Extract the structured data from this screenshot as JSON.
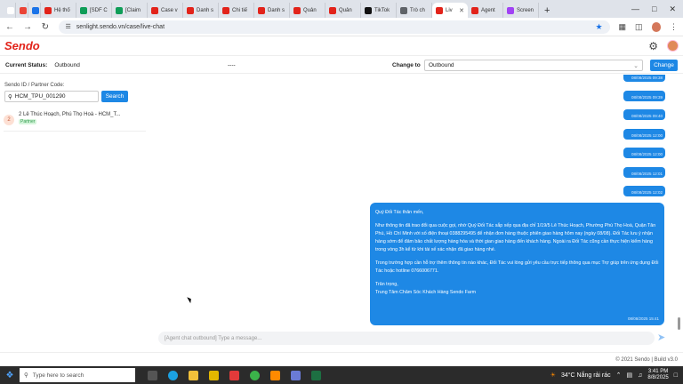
{
  "browser": {
    "tabs": [
      {
        "label": "",
        "color": "#ffffff"
      },
      {
        "label": "",
        "color": "#ea4335"
      },
      {
        "label": "",
        "color": "#1a73e8"
      },
      {
        "label": "Hệ thố",
        "color": "#e2231a"
      },
      {
        "label": "[SDF C",
        "color": "#0f9d58"
      },
      {
        "label": "[Claim",
        "color": "#0f9d58"
      },
      {
        "label": "Case v",
        "color": "#e2231a"
      },
      {
        "label": "Danh s",
        "color": "#e2231a"
      },
      {
        "label": "Chi tiế",
        "color": "#e2231a"
      },
      {
        "label": "Danh s",
        "color": "#e2231a"
      },
      {
        "label": "Quản",
        "color": "#e2231a"
      },
      {
        "label": "Quản",
        "color": "#e2231a"
      },
      {
        "label": "TikTok",
        "color": "#111111"
      },
      {
        "label": "Trò ch",
        "color": "#5f6368"
      },
      {
        "label": "Liv",
        "color": "#e2231a",
        "active": true
      },
      {
        "label": "Agent",
        "color": "#e2231a"
      },
      {
        "label": "Screen",
        "color": "#a142f4"
      }
    ],
    "new_tab": "+",
    "url": "senlight.sendo.vn/case/live-chat"
  },
  "app": {
    "logo": "Sendo",
    "status": {
      "label": "Current Status:",
      "value": "Outbound",
      "middle": "----",
      "change_to_label": "Change to",
      "select_value": "Outbound",
      "change_button": "Change"
    }
  },
  "left_panel": {
    "id_label": "Sendo ID / Partner Code:",
    "id_value": "HCM_TPU_001290",
    "search_button": "Search",
    "contact": {
      "avatar_initial": "2",
      "name": "2 Lê Thúc Hoạch, Phú Thọ Hoà - HCM_T...",
      "badge": "Partner"
    }
  },
  "chat": {
    "small_messages": [
      {
        "time": "08/08/2025 09:38"
      },
      {
        "time": "08/08/2025 09:39"
      },
      {
        "time": "08/08/2025 09:40"
      },
      {
        "time": "08/08/2025 12:00"
      },
      {
        "time": "08/08/2025 12:00"
      },
      {
        "time": "08/08/2025 12:01"
      },
      {
        "time": "08/08/2025 12:02"
      }
    ],
    "big_message": {
      "p1": "Quý Đối Tác thân mến,",
      "p2": "Như thông tin đã trao đổi qua cuộc gọi, nhờ Quý Đối Tác sắp xếp qua địa chỉ 1/19/5 Lê Thúc Hoạch, Phường Phú Thọ Hoà, Quận Tân Phú, Hồ Chí Minh với số điện thoại 0388295495 để nhận đơn hàng thuộc phiên giao hàng hôm nay (ngày 08/08). Đối Tác lưu ý nhận hàng sớm để đảm bảo chất lượng hàng hóa và thời gian giao hàng đến khách hàng. Ngoài ra Đối Tác cũng cần thực hiện kiểm hàng trong vòng 3h kể từ khi tài xế xác nhận đã giao hàng nhé.",
      "p3": "Trong trường hợp cần hỗ trợ thêm thông tin nào khác, Đối Tác vui lòng gửi yêu cầu trực tiếp thông qua mục Trợ giúp trên ứng dụng Đối Tác hoặc hotline 0766006771.",
      "p4": "Trân trọng,",
      "p5": "Trung Tâm Chăm Sóc Khách Hàng Sendo Farm",
      "time": "08/08/2025 15:41"
    },
    "composer_placeholder": "[Agent chat outbound] Type a message..."
  },
  "footer": "© 2021 Sendo | Build v3.0",
  "taskbar": {
    "search_placeholder": "Type here to search",
    "weather": "34°C  Nắng rải rác",
    "time": "3:41 PM",
    "date": "8/8/2025"
  },
  "colors": {
    "brand": "#e2231a",
    "accent": "#1e88e5"
  }
}
